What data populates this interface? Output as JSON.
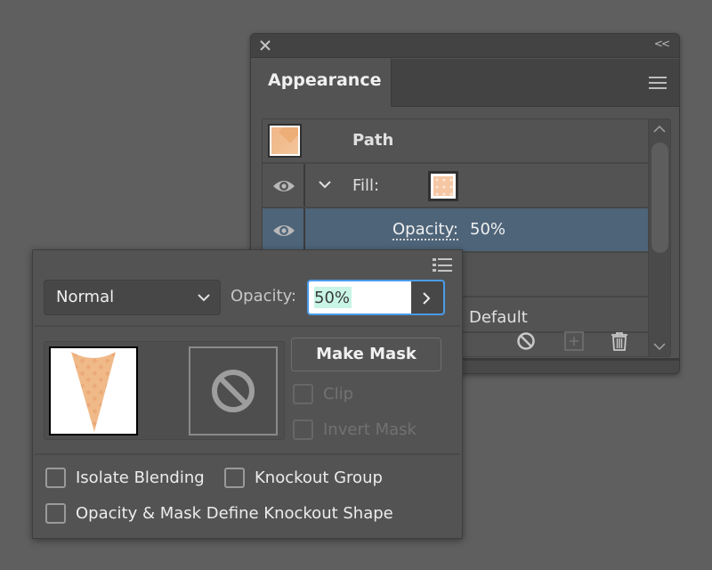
{
  "appearance_panel": {
    "collapse_label": "<<",
    "tab_label": "Appearance",
    "rows": {
      "path_label": "Path",
      "fill_label": "Fill:",
      "opacity_label": "Opacity:",
      "opacity_value": "50%",
      "default_label": "Default"
    },
    "colors": {
      "selected_row": "#4e6479",
      "panel_bg": "#535353"
    },
    "icons": {
      "close": "close-icon",
      "collapse": "double-chevron-left-icon",
      "menu": "hamburger-menu-icon",
      "visibility": "eye-icon",
      "expand": "chevron-down-icon",
      "clear": "no-sign-icon",
      "add": "add-new-icon",
      "delete": "trash-icon"
    }
  },
  "transparency_panel": {
    "blend_mode": "Normal",
    "opacity_label": "Opacity:",
    "opacity_value": "50%",
    "make_mask_label": "Make Mask",
    "clip_label": "Clip",
    "invert_mask_label": "Invert Mask",
    "isolate_blending_label": "Isolate Blending",
    "knockout_group_label": "Knockout Group",
    "opacity_mask_knockout_label": "Opacity & Mask Define Knockout Shape",
    "checkboxes": {
      "clip": false,
      "invert_mask": false,
      "isolate_blending": false,
      "knockout_group": false,
      "opacity_mask_knockout": false
    },
    "colors": {
      "focus_ring": "#4a9be9",
      "text_selection": "#c8f5e6",
      "cone_fill": "#f0b988"
    }
  }
}
